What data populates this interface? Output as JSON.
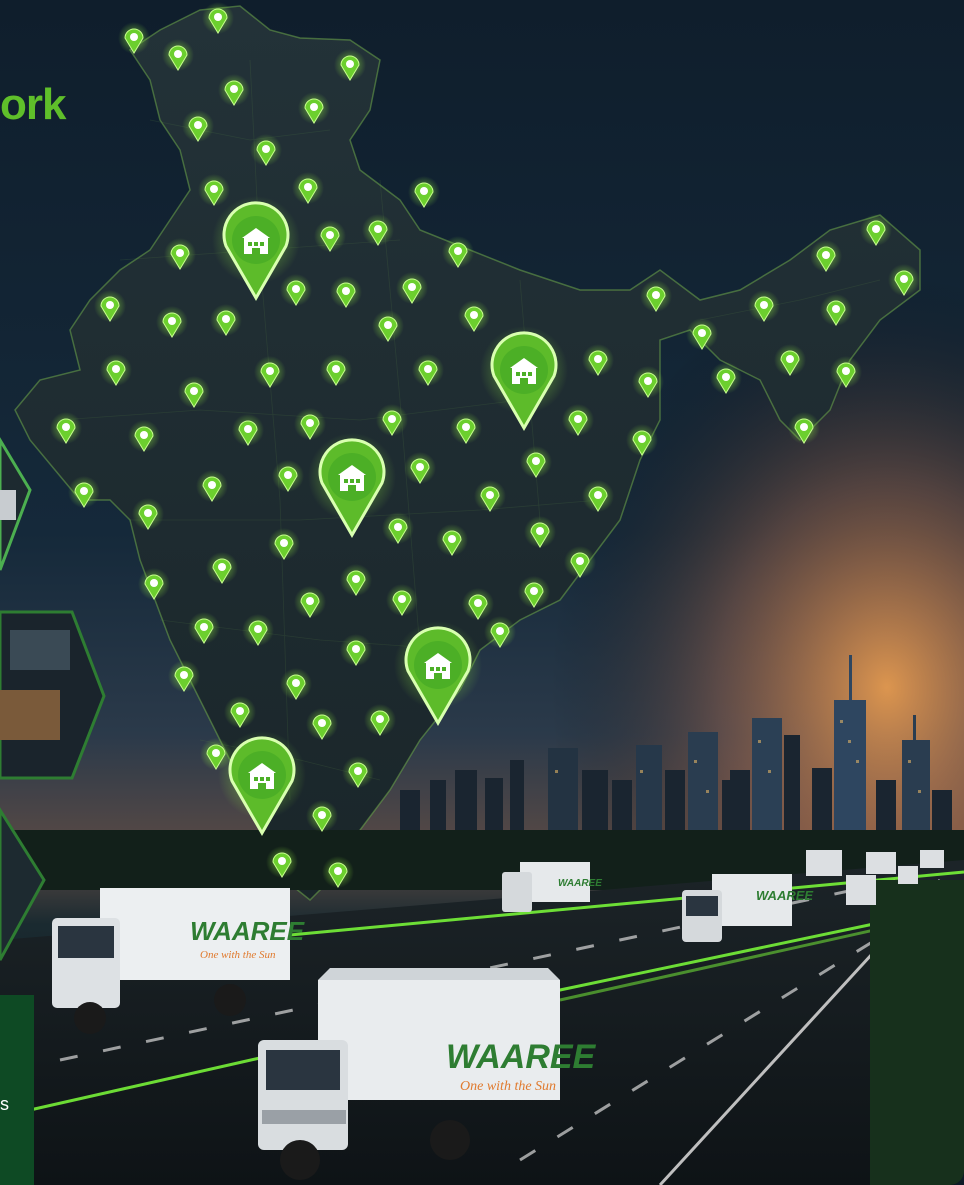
{
  "title_fragment": "ork",
  "card_text_fragment": "s",
  "truck_branding": {
    "logo": "WAAREE",
    "tagline": "One with the Sun"
  },
  "colors": {
    "accent_green": "#5fbf2a",
    "pin_green": "#7ed321",
    "sky_top": "#0f1e2c",
    "sunset": "#e8893a",
    "dark_green_card": "#0e4a24"
  },
  "icons": {
    "warehouse_pin": "warehouse-pin-icon",
    "location_pin": "location-pin-icon"
  }
}
